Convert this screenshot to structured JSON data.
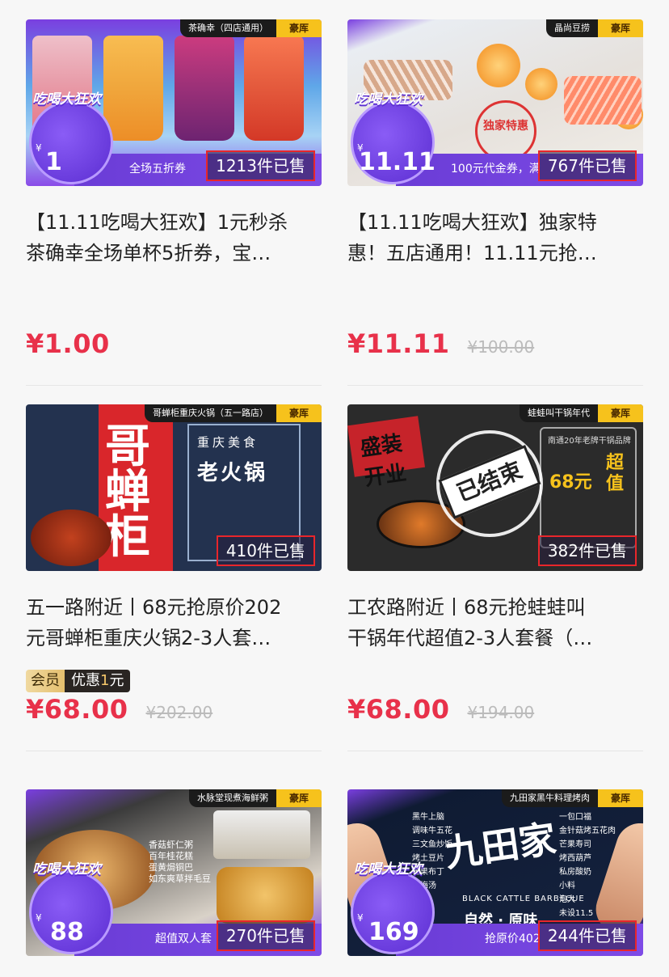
{
  "cards": [
    {
      "shop": "茶确幸（四店通用）",
      "brand": "豪厍",
      "sold": "1213件已售",
      "promo": {
        "badge": "吃喝大狂欢",
        "yen": "¥",
        "price": "1",
        "text": "全场五折券"
      },
      "title_lines": [
        "【11.11吃喝大狂欢】1元秒杀",
        "茶确幸全场单杯5折券，宝…"
      ],
      "price": "¥1.00",
      "orig_price": ""
    },
    {
      "shop": "晶尚豆捞",
      "brand": "豪厍",
      "sold": "767件已售",
      "stamp": "独家特惠",
      "promo": {
        "badge": "吃喝大狂欢",
        "yen": "¥",
        "price": "11.11",
        "text": "100元代金券，满"
      },
      "title_lines": [
        "【11.11吃喝大狂欢】独家特",
        "惠！五店通用！11.11元抢…"
      ],
      "price": "¥11.11",
      "orig_price": "¥100.00"
    },
    {
      "shop": "哥蝉柜重庆火锅（五一路店）",
      "brand": "豪厍",
      "sold": "410件已售",
      "banner": "哥蝉柜",
      "box_small": "重庆美食",
      "box_big": "老火锅",
      "title_lines": [
        "五一路附近丨68元抢原价202",
        "元哥蝉柜重庆火锅2-3人套…"
      ],
      "member": {
        "left": "会员",
        "right_prefix": "优惠",
        "right_value": "1",
        "right_suffix": "元"
      },
      "price": "¥68.00",
      "orig_price": "¥202.00"
    },
    {
      "shop": "蛙蛙叫干锅年代",
      "brand": "豪厍",
      "sold": "382件已售",
      "ended": "已结束",
      "red_square": "盛装开业",
      "right_note": "南通20年老牌干锅品牌",
      "right_big": "68元",
      "right_big2": "超值",
      "title_lines": [
        "工农路附近丨68元抢蛙蛙叫",
        "干锅年代超值2-3人套餐（…"
      ],
      "price": "¥68.00",
      "orig_price": "¥194.00"
    },
    {
      "shop": "水脉堂现煮海鲜粥",
      "brand": "豪厍",
      "sold": "270件已售",
      "menu": [
        "香菇虾仁粥",
        "百年桂花糕",
        "蛋黄焗铜巴",
        "如东爽草拌毛豆"
      ],
      "promo": {
        "badge": "吃喝大狂欢",
        "yen": "¥",
        "price": "88",
        "text": "超值双人套"
      },
      "title_lines": [],
      "price": "",
      "orig_price": ""
    },
    {
      "shop": "九田家黑牛料理烤肉",
      "brand": "豪厍",
      "sold": "244件已售",
      "bbq_title": "九田家",
      "bbq_sub": "BLACK CATTLE BARBECUE",
      "bbq_slogan": "自然 · 原味",
      "list_left": [
        "黑牛上脑",
        "调味牛五花",
        "三文鱼炒饭",
        "烤土豆片",
        "芒果布丁",
        "酸梅汤"
      ],
      "list_right": [
        "一包口福",
        "金针菇烤五花肉",
        "芒果寿司",
        "烤西葫芦",
        "私房酸奶",
        "小料",
        "泡大",
        "未设11.5"
      ],
      "promo": {
        "badge": "吃喝大狂欢",
        "yen": "¥",
        "price": "169",
        "text": "抢原价402"
      },
      "title_lines": [],
      "price": "",
      "orig_price": ""
    }
  ]
}
